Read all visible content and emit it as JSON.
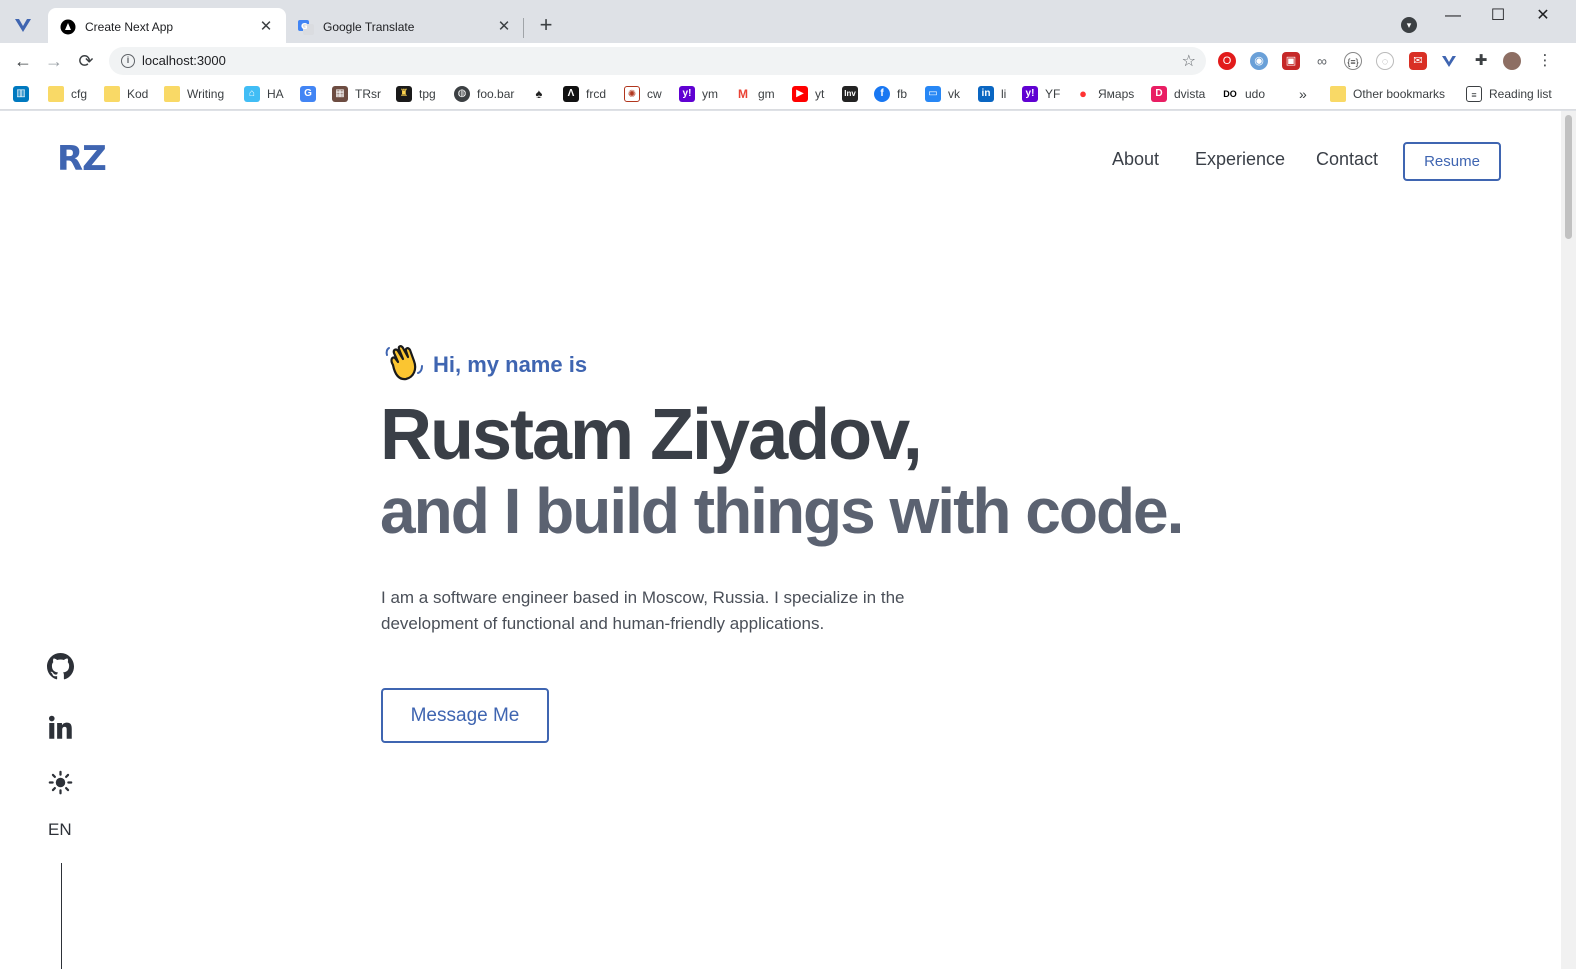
{
  "browser": {
    "tabs": [
      {
        "title": "Create Next App",
        "active": true,
        "icon": "nextjs-icon"
      },
      {
        "title": "Google Translate",
        "active": false,
        "icon": "google-translate-icon"
      }
    ],
    "address": "localhost:3000",
    "bookmarks": [
      {
        "label": "",
        "icon": "trello-icon"
      },
      {
        "label": "cfg",
        "icon": "folder-icon"
      },
      {
        "label": "Kod",
        "icon": "folder-icon"
      },
      {
        "label": "Writing",
        "icon": "folder-icon"
      },
      {
        "label": "HA",
        "icon": "home-assistant-icon"
      },
      {
        "label": "",
        "icon": "translate-icon"
      },
      {
        "label": "TRsr",
        "icon": "trsr-icon"
      },
      {
        "label": "tpg",
        "icon": "tpg-icon"
      },
      {
        "label": "foo.bar",
        "icon": "globe-icon"
      },
      {
        "label": "",
        "icon": "spade-icon"
      },
      {
        "label": "frcd",
        "icon": "frcd-icon"
      },
      {
        "label": "cw",
        "icon": "codewars-icon"
      },
      {
        "label": "ym",
        "icon": "yahoo-icon"
      },
      {
        "label": "gm",
        "icon": "gmail-icon"
      },
      {
        "label": "yt",
        "icon": "youtube-icon"
      },
      {
        "label": "",
        "icon": "inv-icon"
      },
      {
        "label": "fb",
        "icon": "facebook-icon"
      },
      {
        "label": "vk",
        "icon": "vk-icon"
      },
      {
        "label": "li",
        "icon": "linkedin-icon"
      },
      {
        "label": "YF",
        "icon": "yahoo-finance-icon"
      },
      {
        "label": "Ямaps",
        "icon": "map-pin-icon"
      },
      {
        "label": "dvista",
        "icon": "dvista-icon"
      },
      {
        "label": "udo",
        "icon": "udo-icon"
      }
    ],
    "overflow": "»",
    "other_bookmarks": "Other bookmarks",
    "reading_list": "Reading list"
  },
  "page": {
    "logo": "RZ",
    "nav": [
      "About",
      "Experience",
      "Contact"
    ],
    "resume": "Resume",
    "hero": {
      "intro": "Hi, my name is",
      "name": "Rustam Ziyadov,",
      "tagline": "and I build things with code.",
      "description": "I am a software engineer based in Moscow, Russia. I specialize in the development of functional and human-friendly applications.",
      "cta": "Message Me"
    },
    "sidebar": {
      "icons": [
        "github-icon",
        "linkedin-icon",
        "theme-toggle-icon"
      ],
      "language": "EN"
    }
  },
  "colors": {
    "accent": "#3f65b1",
    "heading": "#3a3f47",
    "subheading": "#5b6271"
  }
}
